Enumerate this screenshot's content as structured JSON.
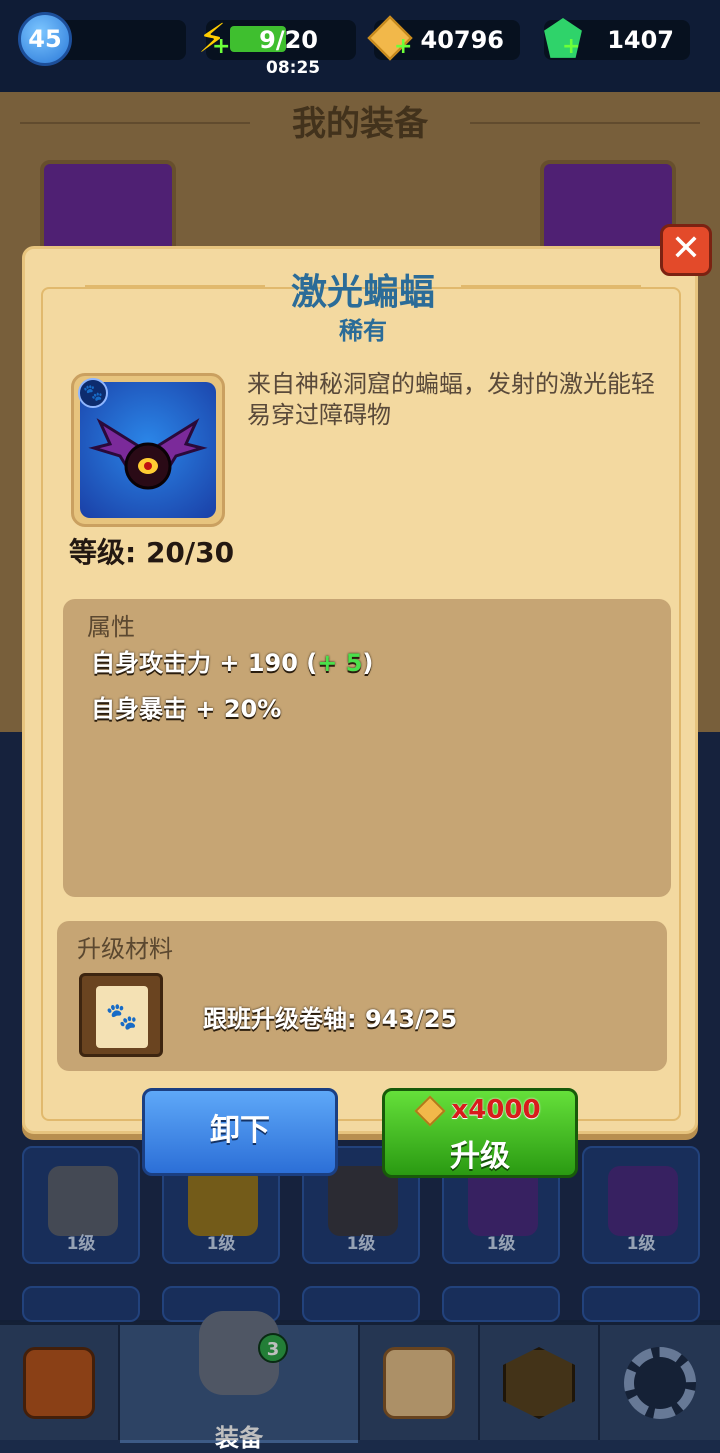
{
  "topbar": {
    "player_level": "45",
    "energy": "9/20",
    "energy_timer": "08:25",
    "gold": "40796",
    "gems": "1407",
    "energy_fill": 0.45
  },
  "background": {
    "title": "我的装备"
  },
  "modal": {
    "title": "激光蝙蝠",
    "rarity": "稀有",
    "description": "来自神秘洞窟的蝙蝠，发射的激光能轻易穿过障碍物",
    "level_text": "等级: 20/30",
    "stats": {
      "title": "属性",
      "attack_label": "自身攻击力 + 190 (",
      "attack_bonus": "+ 5",
      "attack_close": ")",
      "crit": "自身暴击 + 20%"
    },
    "materials": {
      "title": "升级材料",
      "item_text": "跟班升级卷轴: 943/25"
    },
    "unequip_label": "卸下",
    "upgrade_cost": "x4000",
    "upgrade_label": "升级"
  },
  "grid": {
    "levels": [
      "1级",
      "1级",
      "1级",
      "1级",
      "1级"
    ]
  },
  "bottom_nav": {
    "equip_label": "装备",
    "equip_badge": "3"
  },
  "colors": {
    "title_blue": "#2b6c98",
    "modal_bg": "#f3d9a0",
    "upgrade_green": "#2a9a12",
    "unequip_blue": "#2c6fd7",
    "close_red": "#e34a2a"
  }
}
